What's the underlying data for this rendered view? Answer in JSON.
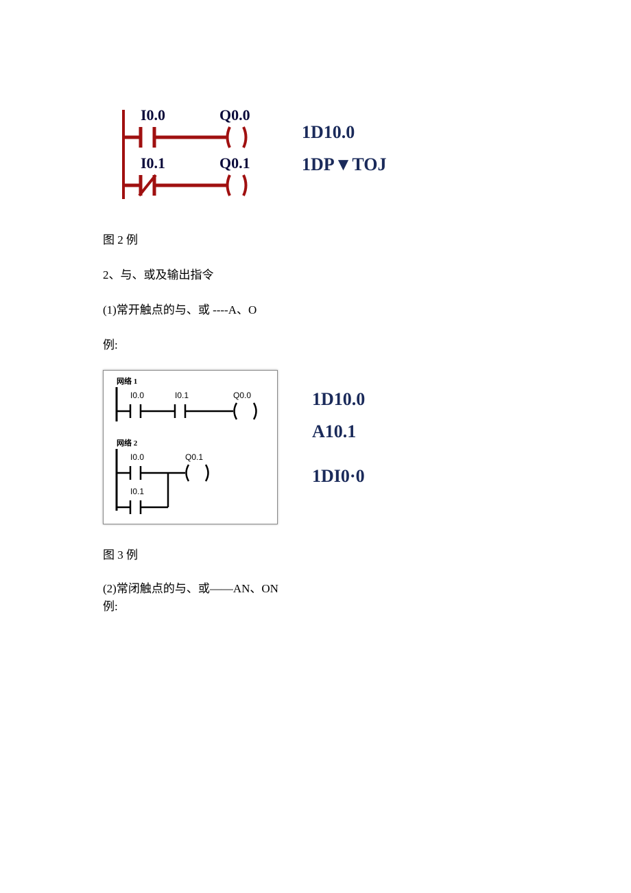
{
  "figure1": {
    "diagram": {
      "rung1": {
        "input_label": "I0.0",
        "output_label": "Q0.0"
      },
      "rung2": {
        "input_label": "I0.1",
        "output_label": "Q0.1"
      }
    },
    "code": {
      "line1": "1D10.0",
      "line2": "1DP▼TOJ"
    }
  },
  "caption1": "图 2 例",
  "heading1": "2、与、或及输出指令",
  "subheading1": "(1)常开触点的与、或 ----A、O",
  "example_label": "例:",
  "figure2": {
    "diagram": {
      "net1_label": "网络 1",
      "net1_in1": "I0.0",
      "net1_in2": "I0.1",
      "net1_out": "Q0.0",
      "net2_label": "网络 2",
      "net2_in1": "I0.0",
      "net2_in2": "I0.1",
      "net2_out": "Q0.1"
    },
    "code": {
      "line1": "1D10.0",
      "line2": "A10.1",
      "line3": "1DI0·0"
    }
  },
  "caption2": "图 3 例",
  "subheading2": "(2)常闭触点的与、或——AN、ON",
  "example_label2": "例:"
}
